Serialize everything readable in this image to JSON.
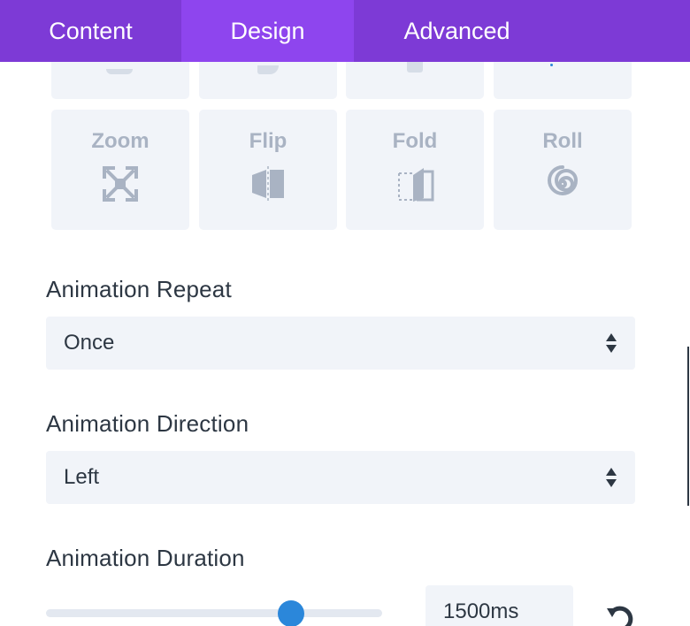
{
  "tabs": [
    {
      "label": "Content",
      "active": false
    },
    {
      "label": "Design",
      "active": true
    },
    {
      "label": "Advanced",
      "active": false
    }
  ],
  "animation_styles": [
    {
      "label": "Zoom",
      "icon": "zoom-icon"
    },
    {
      "label": "Flip",
      "icon": "flip-icon"
    },
    {
      "label": "Fold",
      "icon": "fold-icon"
    },
    {
      "label": "Roll",
      "icon": "roll-icon"
    }
  ],
  "repeat": {
    "label": "Animation Repeat",
    "value": "Once"
  },
  "direction": {
    "label": "Animation Direction",
    "value": "Left"
  },
  "duration": {
    "label": "Animation Duration",
    "value": "1500ms",
    "slider_fraction": 0.73
  },
  "colors": {
    "tab_bar": "#7d3ad6",
    "tab_active": "#8e45ee",
    "tile_bg": "#f1f4f9",
    "tile_fg": "#a9b3c3",
    "slider_accent": "#2b87da",
    "text": "#2d3743"
  }
}
